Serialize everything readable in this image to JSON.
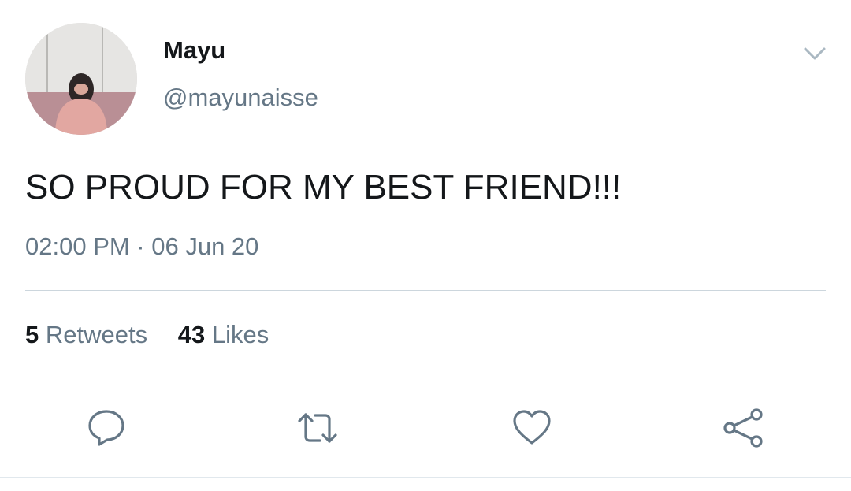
{
  "user": {
    "display_name": "Mayu",
    "handle": "@mayunaisse"
  },
  "tweet": {
    "text": "SO PROUD FOR MY BEST FRIEND!!!",
    "timestamp": "02:00 PM · 06 Jun 20"
  },
  "stats": {
    "retweets_count": "5",
    "retweets_label": "Retweets",
    "likes_count": "43",
    "likes_label": "Likes"
  },
  "actions": [
    {
      "icon": "reply-icon"
    },
    {
      "icon": "retweet-icon"
    },
    {
      "icon": "like-icon"
    },
    {
      "icon": "share-icon"
    }
  ],
  "colors": {
    "text_primary": "#14171a",
    "text_secondary": "#657786",
    "divider": "#ccd6dd"
  }
}
